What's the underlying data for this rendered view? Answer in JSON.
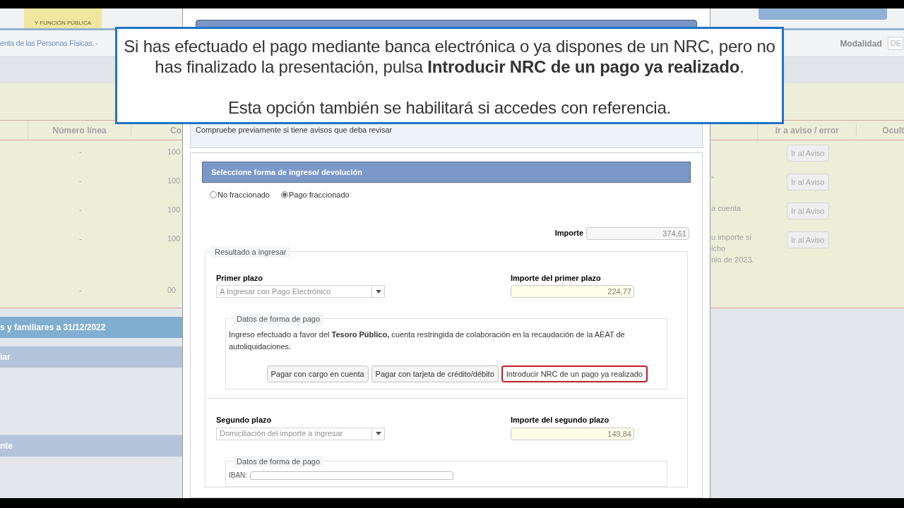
{
  "background_page": {
    "logo_text": "Y FUNCIÓN PÚBLICA",
    "left": {
      "breadcrumb": "enta de las Personas Físicas. -",
      "table": {
        "columns": [
          "Número línea",
          "Co"
        ],
        "rows": [
          [
            "-",
            "100"
          ],
          [
            "-",
            "100"
          ],
          [
            "-",
            "100"
          ],
          [
            "-",
            "100"
          ],
          [
            "-",
            "00"
          ]
        ]
      },
      "sections": [
        "s y familiares a 31/12/2022",
        "iar",
        "nte"
      ]
    },
    "right": {
      "modalidad_label": "Modalidad",
      "modalidad_value": "DE",
      "table": {
        "columns": [
          "Ir a aviso / error",
          "Ocult"
        ],
        "rows": [
          {
            "lines": [],
            "button": "Ir al Aviso"
          },
          {
            "lines": [
              "\""
            ],
            "button": "Ir al Aviso"
          },
          {
            "lines": [
              "a cuenta"
            ],
            "button": "Ir al Aviso"
          },
          {
            "lines": [
              "u importe si",
              "icho",
              "nio de 2023."
            ],
            "button": "Ir al Aviso"
          }
        ]
      }
    }
  },
  "modal": {
    "notice": "Compruebe previamente si tiene avisos que deba revisar",
    "section_title": "Seleccione forma de ingreso/ devolución",
    "options": [
      {
        "label": "No fraccionado",
        "selected": false
      },
      {
        "label": "Pago fraccionado",
        "selected": true
      }
    ],
    "importe": {
      "label": "Importe",
      "value": "374,61"
    },
    "result_group": {
      "legend": "Resultado a ingresar",
      "plazos": [
        {
          "label": "Primer plazo",
          "select": "A Ingresar con Pago Electrónico",
          "amount_label": "Importe del primer plazo",
          "amount": "224,77",
          "payment": {
            "legend": "Datos de forma de pago",
            "text": "Ingreso efectuado a favor del **Tesoro Público,** cuenta restringida de colaboración en la recaudación de la AEAT de autoliquidaciones.",
            "buttons": [
              {
                "label": "Pagar con cargo en cuenta",
                "highlighted": false
              },
              {
                "label": "Pagar con tarjeta de crédito/débito",
                "highlighted": false
              },
              {
                "label": "Introducir NRC de un pago ya realizado",
                "highlighted": true
              }
            ]
          }
        },
        {
          "label": "Segundo plazo",
          "select": "Domiciliación del importe a ingresar",
          "amount_label": "Importe del segundo plazo",
          "amount": "149,84",
          "payment": {
            "legend": "Datos de forma de pago",
            "iban_label": "IBAN:"
          }
        }
      ]
    }
  },
  "callout": {
    "paragraphs": [
      "Si has efectuado el pago mediante banca electrónica o ya dispones de un NRC, pero no has finalizado la presentación, pulsa **Introducir NRC de un pago ya realizado**.",
      "Esta opción también se habilitará si accedes con referencia."
    ]
  }
}
